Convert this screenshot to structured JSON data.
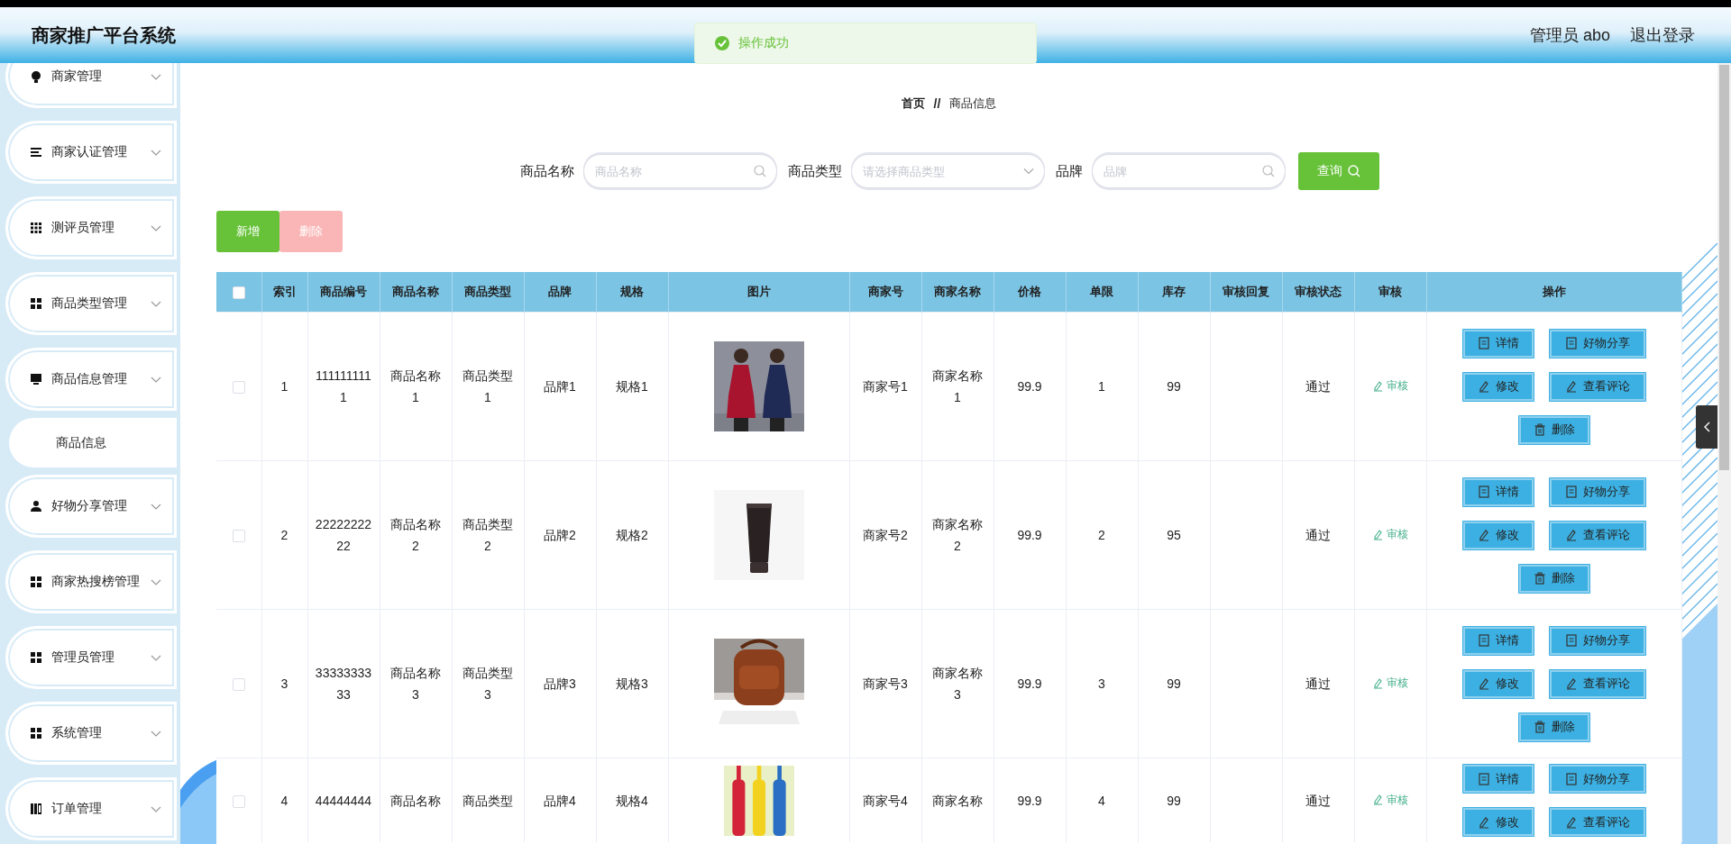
{
  "header": {
    "title": "商家推广平台系统",
    "user": "管理员 abo",
    "logout": "退出登录"
  },
  "toast": {
    "message": "操作成功"
  },
  "sidebar": {
    "items": [
      {
        "label": "商家管理"
      },
      {
        "label": "商家认证管理"
      },
      {
        "label": "测评员管理"
      },
      {
        "label": "商品类型管理"
      },
      {
        "label": "商品信息管理",
        "children": [
          {
            "label": "商品信息"
          }
        ]
      },
      {
        "label": "好物分享管理"
      },
      {
        "label": "商家热搜榜管理"
      },
      {
        "label": "管理员管理"
      },
      {
        "label": "系统管理"
      },
      {
        "label": "订单管理"
      }
    ]
  },
  "breadcrumb": {
    "items": [
      "首页",
      "商品信息"
    ],
    "separator": "//"
  },
  "search": {
    "fields": [
      {
        "kind": "text",
        "label": "商品名称",
        "placeholder": "商品名称"
      },
      {
        "kind": "select",
        "label": "商品类型",
        "placeholder": "请选择商品类型"
      },
      {
        "kind": "text",
        "label": "品牌",
        "placeholder": "品牌"
      }
    ],
    "button": "查询"
  },
  "actions": [
    {
      "kind": "add",
      "label": "新增",
      "disabled": false
    },
    {
      "kind": "delete",
      "label": "删除",
      "disabled": true
    }
  ],
  "table": {
    "select_all": {
      "checked": false
    },
    "columns": [
      "索引",
      "商品编号",
      "商品名称",
      "商品类型",
      "品牌",
      "规格",
      "图片",
      "商家号",
      "商家名称",
      "价格",
      "单限",
      "库存",
      "审核回复",
      "审核状态",
      "审核",
      "操作"
    ],
    "rows": [
      {
        "checked": false,
        "index": "1",
        "code": "1111111111",
        "name": "商品名称1",
        "type": "商品类型1",
        "brand": "品牌1",
        "spec": "规格1",
        "merchant_no": "商家号1",
        "merchant_name": "商家名称1",
        "price": "99.9",
        "limit": "1",
        "stock": "99",
        "status": "通过",
        "audit": "审核",
        "buttons": [
          {
            "kind": "detail",
            "label": "详情"
          },
          {
            "kind": "share",
            "label": "好物分享"
          },
          {
            "kind": "edit",
            "label": "修改"
          },
          {
            "kind": "comments",
            "label": "查看评论"
          },
          {
            "kind": "delete",
            "label": "删除"
          }
        ]
      },
      {
        "checked": false,
        "index": "2",
        "code": "2222222222",
        "name": "商品名称2",
        "type": "商品类型2",
        "brand": "品牌2",
        "spec": "规格2",
        "merchant_no": "商家号2",
        "merchant_name": "商家名称2",
        "price": "99.9",
        "limit": "2",
        "stock": "95",
        "status": "通过",
        "audit": "审核",
        "buttons": [
          {
            "kind": "detail",
            "label": "详情"
          },
          {
            "kind": "share",
            "label": "好物分享"
          },
          {
            "kind": "edit",
            "label": "修改"
          },
          {
            "kind": "comments",
            "label": "查看评论"
          },
          {
            "kind": "delete",
            "label": "删除"
          }
        ]
      },
      {
        "checked": false,
        "index": "3",
        "code": "3333333333",
        "name": "商品名称3",
        "type": "商品类型3",
        "brand": "品牌3",
        "spec": "规格3",
        "merchant_no": "商家号3",
        "merchant_name": "商家名称3",
        "price": "99.9",
        "limit": "3",
        "stock": "99",
        "status": "通过",
        "audit": "审核",
        "buttons": [
          {
            "kind": "detail",
            "label": "详情"
          },
          {
            "kind": "share",
            "label": "好物分享"
          },
          {
            "kind": "edit",
            "label": "修改"
          },
          {
            "kind": "comments",
            "label": "查看评论"
          },
          {
            "kind": "delete",
            "label": "删除"
          }
        ]
      },
      {
        "checked": false,
        "index": "4",
        "code": "44444444",
        "name": "商品名称",
        "type": "商品类型",
        "brand": "品牌4",
        "spec": "规格4",
        "merchant_no": "商家号4",
        "merchant_name": "商家名称",
        "price": "99.9",
        "limit": "4",
        "stock": "99",
        "status": "通过",
        "audit": "审核",
        "buttons": [
          {
            "kind": "detail",
            "label": "详情"
          },
          {
            "kind": "share",
            "label": "好物分享"
          },
          {
            "kind": "edit",
            "label": "修改"
          },
          {
            "kind": "comments",
            "label": "查看评论"
          }
        ]
      }
    ]
  }
}
